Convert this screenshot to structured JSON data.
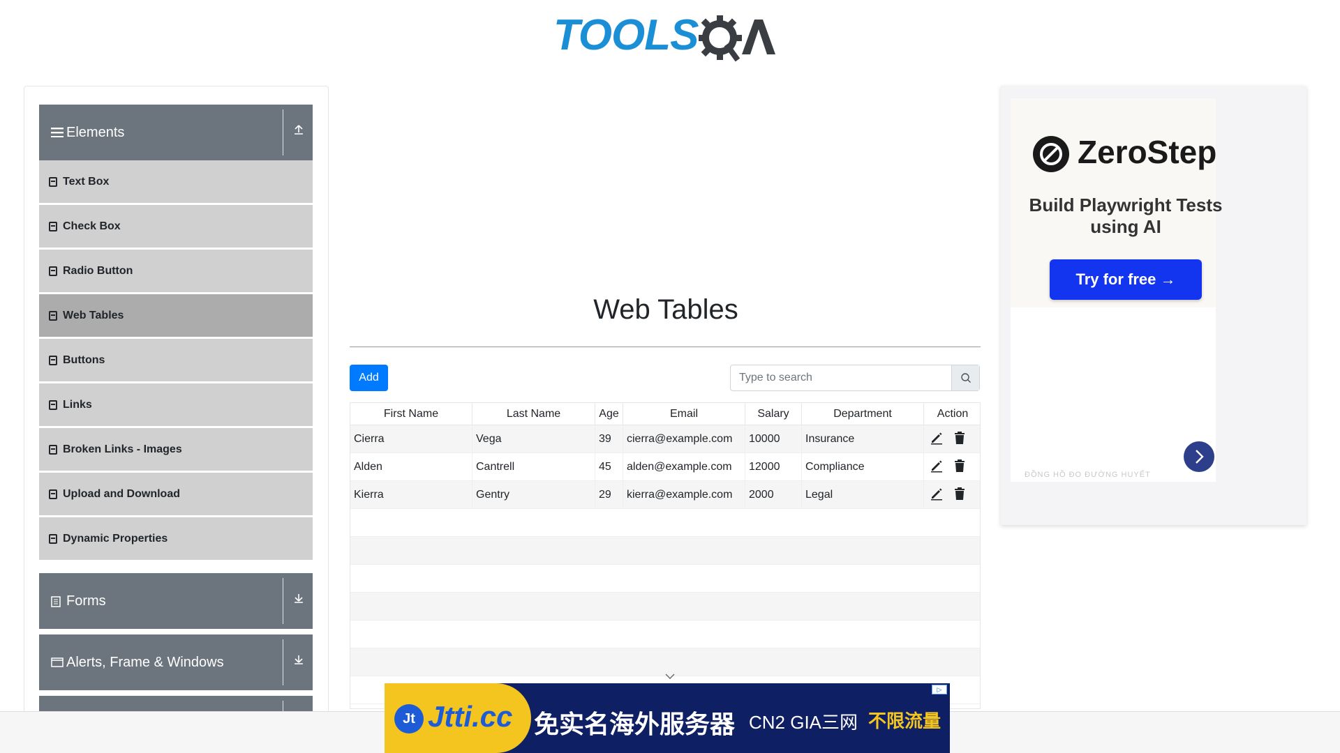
{
  "header": {
    "logo_tools": "TOOLS",
    "logo_qa": "QA"
  },
  "sidebar": {
    "groups": [
      {
        "label": "Elements",
        "expanded": true
      },
      {
        "label": "Forms",
        "expanded": false
      },
      {
        "label": "Alerts, Frame & Windows",
        "expanded": false
      }
    ],
    "items": [
      {
        "label": "Text Box"
      },
      {
        "label": "Check Box"
      },
      {
        "label": "Radio Button"
      },
      {
        "label": "Web Tables",
        "active": true
      },
      {
        "label": "Buttons"
      },
      {
        "label": "Links"
      },
      {
        "label": "Broken Links - Images"
      },
      {
        "label": "Upload and Download"
      },
      {
        "label": "Dynamic Properties"
      }
    ]
  },
  "main": {
    "title": "Web Tables",
    "add_label": "Add",
    "search": {
      "placeholder": "Type to search",
      "value": ""
    },
    "table": {
      "columns": [
        "First Name",
        "Last Name",
        "Age",
        "Email",
        "Salary",
        "Department",
        "Action"
      ],
      "rows": [
        [
          "Cierra",
          "Vega",
          "39",
          "cierra@example.com",
          "10000",
          "Insurance"
        ],
        [
          "Alden",
          "Cantrell",
          "45",
          "alden@example.com",
          "12000",
          "Compliance"
        ],
        [
          "Kierra",
          "Gentry",
          "29",
          "kierra@example.com",
          "2000",
          "Legal"
        ]
      ]
    }
  },
  "ad_right": {
    "brand": "ZeroStep",
    "tagline": "Build Playwright Tests using AI",
    "cta": "Try for free →",
    "small_text": "ĐỒNG HỒ ĐO ĐƯỜNG HUYẾT"
  },
  "banner_ad": {
    "brand": "Jtti.cc",
    "badge": "Jt",
    "text_cn": "免实名海外服务器",
    "text_mid": "CN2 GIA三网",
    "text_highlight": "不限流量"
  },
  "colors": {
    "accent": "#007bff",
    "sidebar_header": "#6c757d",
    "sidebar_item": "#d0d0d0",
    "sidebar_active": "#acacac",
    "logo_blue": "#1b8fd6",
    "ad_cta": "#1435f0"
  }
}
